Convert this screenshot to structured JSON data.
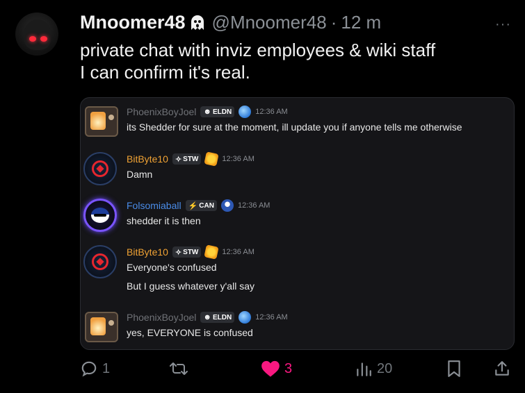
{
  "tweet": {
    "display_name": "Mnoomer48",
    "handle": "@Mnoomer48",
    "separator": "·",
    "time": "12 m",
    "text_line1": "private chat with inviz employees & wiki staff",
    "text_line2": "I can confirm it's real.",
    "more": "···"
  },
  "chat": {
    "messages": [
      {
        "user": "PhoenixBoyJoel",
        "tag": "ELDN",
        "time": "12:36 AM",
        "lines": [
          "its Shedder for sure at the moment, ill update you if anyone tells me otherwise"
        ]
      },
      {
        "user": "BitByte10",
        "tag": "STW",
        "time": "12:36 AM",
        "lines": [
          "Damn"
        ]
      },
      {
        "user": "Folsomiaball",
        "tag": "CAN",
        "time": "12:36 AM",
        "lines": [
          "shedder it is then"
        ]
      },
      {
        "user": "BitByte10",
        "tag": "STW",
        "time": "12:36 AM",
        "lines": [
          "Everyone's confused",
          "But I guess whatever y'all say"
        ]
      },
      {
        "user": "PhoenixBoyJoel",
        "tag": "ELDN",
        "time": "12:36 AM",
        "lines": [
          "yes, EVERYONE is confused"
        ]
      }
    ]
  },
  "actions": {
    "replies": "1",
    "likes": "3",
    "views": "20"
  },
  "colors": {
    "background": "#000000",
    "like": "#f91880",
    "muted": "#71767b"
  }
}
